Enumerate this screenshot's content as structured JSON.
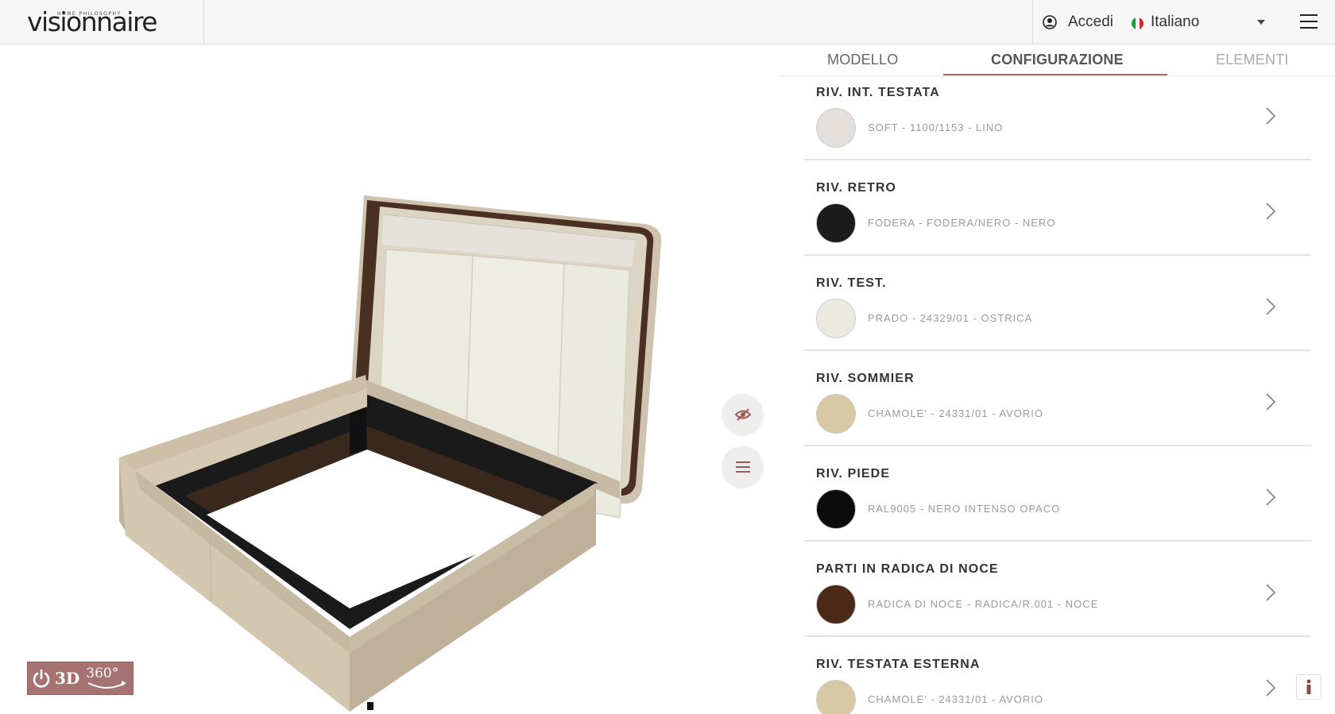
{
  "header": {
    "logo_tagline": "HOME PHILOSOPHY",
    "logo_text": "visionnaire",
    "login_label": "Accedi",
    "language": "Italiano"
  },
  "tabs": [
    {
      "label": "MODELLO",
      "active": false
    },
    {
      "label": "CONFIGURAZIONE",
      "active": true
    },
    {
      "label": "ELEMENTI",
      "active": false
    }
  ],
  "options": [
    {
      "title": "RIV. INT. TESTATA",
      "value": "SOFT - 1100/1153 - LINO",
      "swatch": "#e4dfdb"
    },
    {
      "title": "RIV. RETRO",
      "value": "FODERA - FODERA/NERO - NERO",
      "swatch": "#1b1b1b"
    },
    {
      "title": "RIV. TEST.",
      "value": "PRADO - 24329/01 - OSTRICA",
      "swatch": "#ece9e0"
    },
    {
      "title": "RIV. SOMMIER",
      "value": "CHAMOLE' - 24331/01 - AVORIO",
      "swatch": "#d8c9a4"
    },
    {
      "title": "RIV. PIEDE",
      "value": "RAL9005 - NERO INTENSO OPACO",
      "swatch": "#0c0c0c"
    },
    {
      "title": "PARTI IN RADICA DI NOCE",
      "value": "RADICA DI NOCE - RADICA/R.001 - NOCE",
      "swatch": "#4a2a16"
    },
    {
      "title": "RIV. TESTATA ESTERNA",
      "value": "CHAMOLE' - 24331/01 - AVORIO",
      "swatch": "#d8c9a4"
    }
  ],
  "viewer": {
    "mode_label_3d": "3D",
    "mode_label_360": "360°"
  },
  "colors": {
    "accent": "#b06a60",
    "badge": "#a67372",
    "button_bg": "#f0eded"
  }
}
